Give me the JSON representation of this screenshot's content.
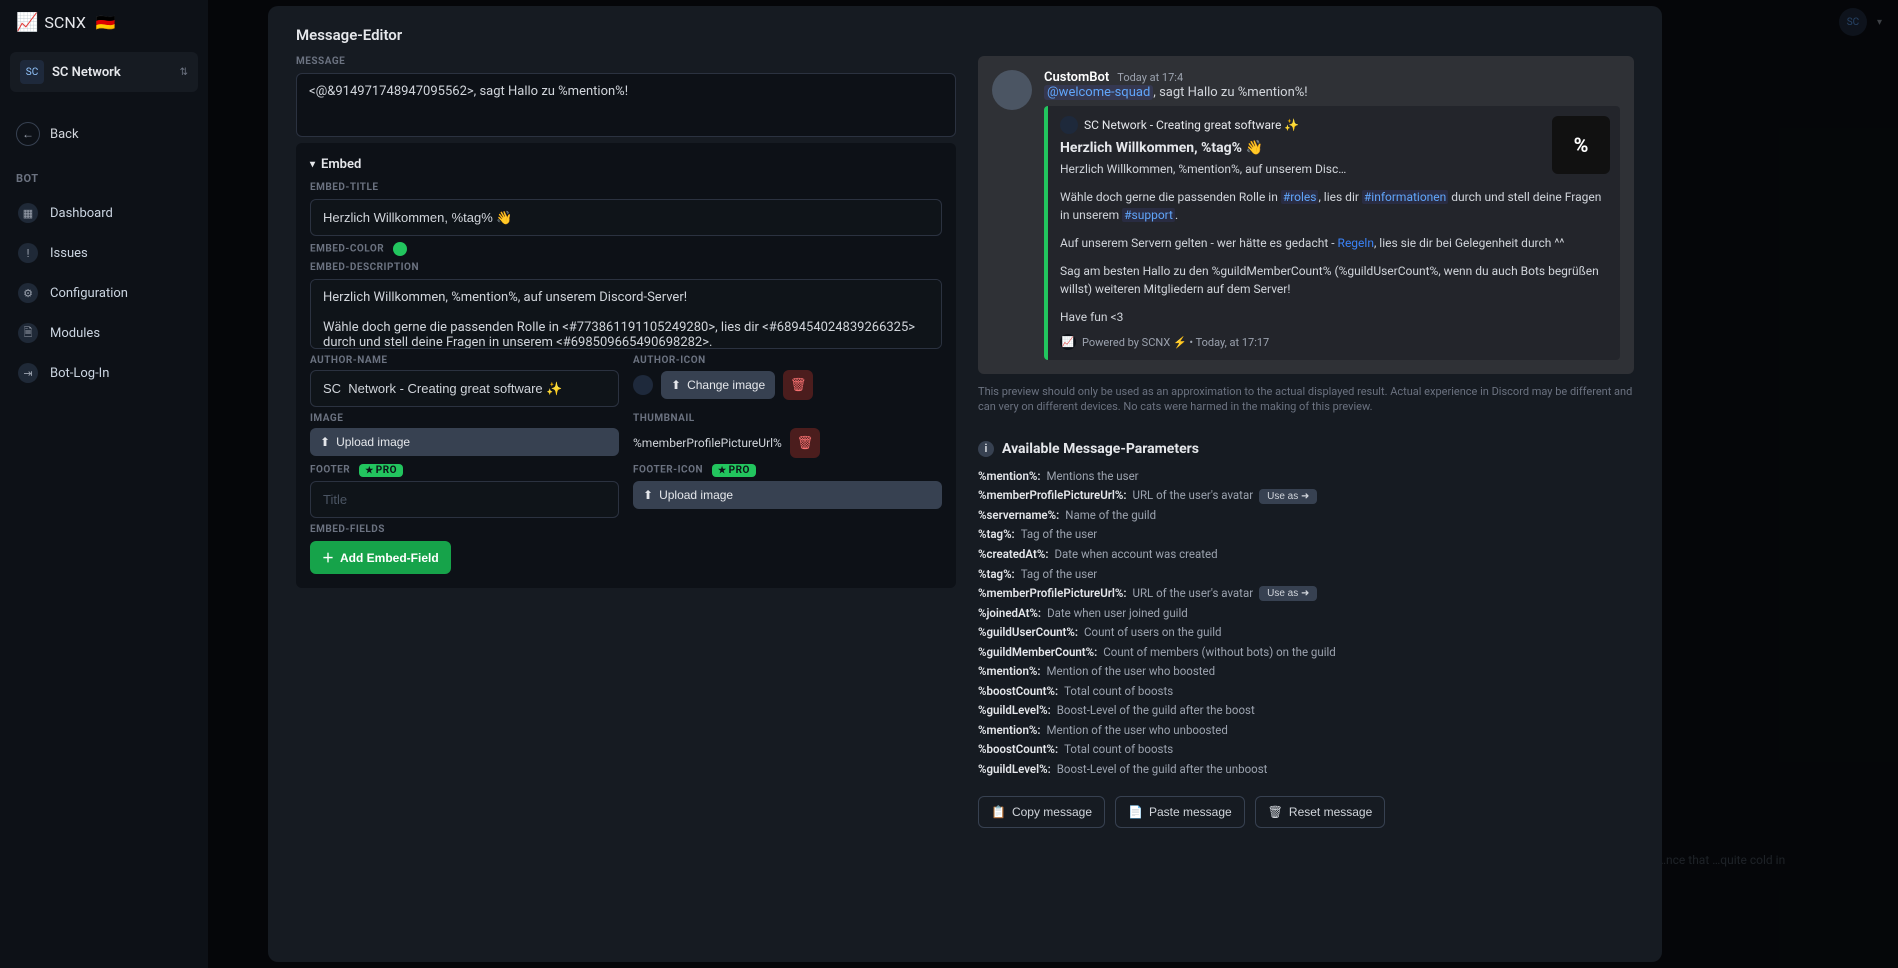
{
  "topbar": {
    "brand": "SCNX",
    "flag": "🇩🇪",
    "avatar_initials": "SC"
  },
  "sidebar": {
    "guild_name": "SC Network",
    "back_label": "Back",
    "section_label": "BOT",
    "items": [
      {
        "label": "Dashboard"
      },
      {
        "label": "Issues"
      },
      {
        "label": "Configuration"
      },
      {
        "label": "Modules"
      },
      {
        "label": "Bot-Log-In"
      }
    ]
  },
  "modal": {
    "title": "Message-Editor",
    "label_message": "MESSAGE",
    "message_value": "<@&914971748947095562>, sagt Hallo zu %mention%!",
    "embed_section_label": "Embed",
    "label_embed_title": "EMBED-TITLE",
    "embed_title_value": "Herzlich Willkommen, %tag% 👋",
    "label_embed_color": "EMBED-COLOR",
    "label_embed_description": "EMBED-DESCRIPTION",
    "embed_description_value": "Herzlich Willkommen, %mention%, auf unserem Discord-Server!\n\nWähle doch gerne die passenden Rolle in <#773861191105249280>, lies dir <#689454024839266325> durch und stell deine Fragen in unserem <#698509665490698282>.",
    "label_author_name": "AUTHOR-NAME",
    "author_name_value": "SC  Network - Creating great software ✨",
    "label_author_icon": "AUTHOR-ICON",
    "change_image_label": "Change image",
    "label_image": "IMAGE",
    "upload_image_label": "Upload image",
    "label_thumbnail": "THUMBNAIL",
    "thumbnail_value": "%memberProfilePictureUrl%",
    "label_footer": "FOOTER",
    "footer_placeholder": "Title",
    "label_footer_icon": "FOOTER-ICON",
    "label_embed_fields": "EMBED-FIELDS",
    "add_field_label": "Add Embed-Field",
    "pro_badge": "PRO"
  },
  "preview": {
    "bot_name": "CustomBot",
    "timestamp": "Today at 17:4",
    "header_line_mention": "@welcome-squad",
    "header_line_rest": ", sagt Hallo zu %mention%!",
    "embed_author": "SC Network - Creating great software ✨",
    "embed_title": "Herzlich Willkommen, %tag% 👋",
    "embed_line1": "Herzlich Willkommen, %mention%, auf unserem Disc…",
    "embed_line2_pre": "Wähle doch gerne die passenden Rolle in ",
    "embed_line2_ch1": "#roles",
    "embed_line2_mid": ", lies dir ",
    "embed_line2_ch2": "#informationen",
    "embed_line2_mid2": " durch und stell deine Fragen in unserem ",
    "embed_line2_ch3": "#support",
    "embed_line3_pre": "Auf unserem Servern gelten - wer hätte es gedacht - ",
    "embed_line3_link": "Regeln",
    "embed_line3_post": ", lies sie dir bei Gelegenheit durch ^^",
    "embed_line4": "Sag am besten Hallo zu den %guildMemberCount% (%guildUserCount%, wenn du auch Bots begrüßen willst) weiteren Mitgliedern auf dem Server!",
    "embed_line5": "Have fun <3",
    "thumb_text": "%",
    "footer_text": "Powered by SCNX ⚡ • Today, at 17:17",
    "note": "This preview should only be used as an approximation to the actual displayed result. Actual experience in Discord may be different and can very on different devices. No cats were harmed in the making of this preview."
  },
  "params": {
    "heading": "Available Message-Parameters",
    "rows": [
      {
        "key": "%mention%:",
        "desc": "Mentions the user",
        "use_as": false
      },
      {
        "key": "%memberProfilePictureUrl%:",
        "desc": "URL of the user's avatar",
        "use_as": true
      },
      {
        "key": "%servername%:",
        "desc": "Name of the guild",
        "use_as": false
      },
      {
        "key": "%tag%:",
        "desc": "Tag of the user",
        "use_as": false
      },
      {
        "key": "%createdAt%:",
        "desc": "Date when account was created",
        "use_as": false
      },
      {
        "key": "%tag%:",
        "desc": "Tag of the user",
        "use_as": false
      },
      {
        "key": "%memberProfilePictureUrl%:",
        "desc": "URL of the user's avatar",
        "use_as": true
      },
      {
        "key": "%joinedAt%:",
        "desc": "Date when user joined guild",
        "use_as": false
      },
      {
        "key": "%guildUserCount%:",
        "desc": "Count of users on the guild",
        "use_as": false
      },
      {
        "key": "%guildMemberCount%:",
        "desc": "Count of members (without bots) on the guild",
        "use_as": false
      },
      {
        "key": "%mention%:",
        "desc": "Mention of the user who boosted",
        "use_as": false
      },
      {
        "key": "%boostCount%:",
        "desc": "Total count of boosts",
        "use_as": false
      },
      {
        "key": "%guildLevel%:",
        "desc": "Boost-Level of the guild after the boost",
        "use_as": false
      },
      {
        "key": "%mention%:",
        "desc": "Mention of the user who unboosted",
        "use_as": false
      },
      {
        "key": "%boostCount%:",
        "desc": "Total count of boosts",
        "use_as": false
      },
      {
        "key": "%guildLevel%:",
        "desc": "Boost-Level of the guild after the unboost",
        "use_as": false
      }
    ],
    "use_as_label": "Use as"
  },
  "actions": {
    "copy": "Copy message",
    "paste": "Paste message",
    "reset": "Reset message"
  },
  "bg_faint": "…nce that …quite cold in"
}
